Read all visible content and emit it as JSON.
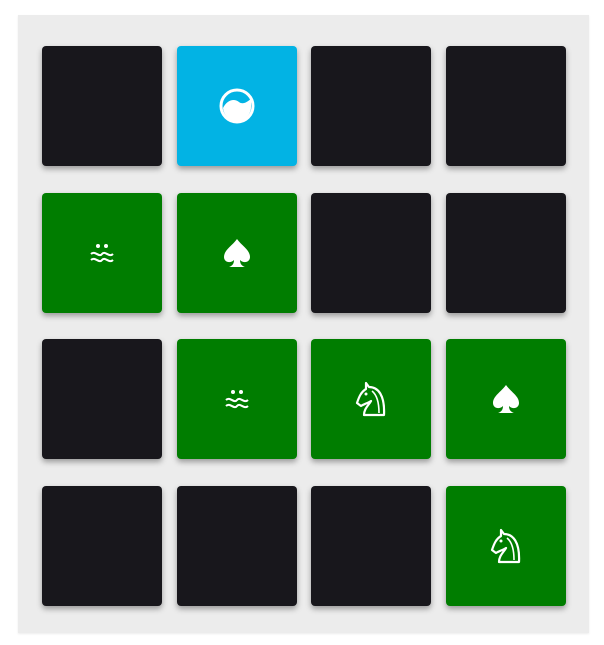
{
  "game": {
    "colors": {
      "board": "#ececec",
      "hidden": "#18171c",
      "matched": "#007d00",
      "open": "#02b3e4",
      "symbol": "#ffffff"
    },
    "cards": [
      {
        "state": "hidden",
        "icon": ""
      },
      {
        "state": "open",
        "icon": "swirl-circle-icon"
      },
      {
        "state": "hidden",
        "icon": ""
      },
      {
        "state": "hidden",
        "icon": ""
      },
      {
        "state": "matched",
        "icon": "wavy-dots-icon"
      },
      {
        "state": "matched",
        "icon": "spade-icon"
      },
      {
        "state": "hidden",
        "icon": ""
      },
      {
        "state": "hidden",
        "icon": ""
      },
      {
        "state": "hidden",
        "icon": ""
      },
      {
        "state": "matched",
        "icon": "wavy-dots-icon"
      },
      {
        "state": "matched",
        "icon": "knight-icon"
      },
      {
        "state": "matched",
        "icon": "spade-icon"
      },
      {
        "state": "hidden",
        "icon": ""
      },
      {
        "state": "hidden",
        "icon": ""
      },
      {
        "state": "hidden",
        "icon": ""
      },
      {
        "state": "matched",
        "icon": "knight-icon"
      }
    ]
  }
}
